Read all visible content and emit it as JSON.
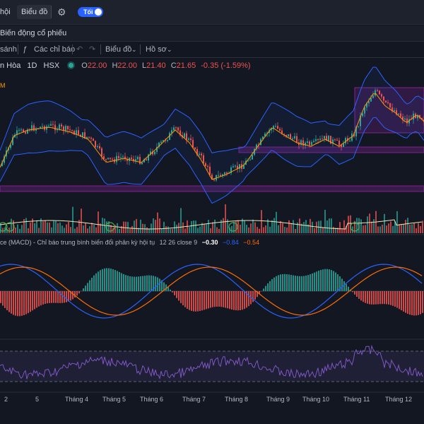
{
  "header": {
    "tab_partial": "hội",
    "chart_tab": "Biểu đồ",
    "toggle_label": "Tối"
  },
  "title_bar": {
    "text": "Biến động cổ phiếu"
  },
  "toolbar": {
    "compare_partial": "sánh",
    "indicators": "Các chỉ báo",
    "chart_type": "Biểu đồ",
    "profile": "Hồ sơ"
  },
  "symbol": {
    "name_partial": "n Hòa",
    "interval": "1D",
    "exchange": "HSX",
    "o_key": "O",
    "o_val": "22.00",
    "h_key": "H",
    "h_val": "22.00",
    "l_key": "L",
    "l_val": "21.40",
    "c_key": "C",
    "c_val": "21.65",
    "change": "-0.35 (-1.59%)",
    "pane_marker": "M"
  },
  "macd_legend": {
    "title": "ce (MACD) - Chỉ báo trung bình biến đổi phân kỳ hội tụ",
    "params": "12 26 close 9",
    "histogram": "−0.30",
    "macd": "−0.84",
    "signal": "−0.54"
  },
  "x_axis": [
    "2",
    "5",
    "Tháng 4",
    "Tháng 5",
    "Tháng 6",
    "Tháng 7",
    "Tháng 8",
    "Tháng 9",
    "Tháng 10",
    "Tháng 11",
    "Tháng 12"
  ],
  "colors": {
    "up": "#26a69a",
    "down": "#ef5350",
    "bollinger": "#2962ff",
    "ma": "#ff9800",
    "macd_line": "#2962ff",
    "signal_line": "#ff6d00",
    "rsi": "#7e57c2",
    "zone": "#9c27b0"
  },
  "icons": {
    "gear": "gear-icon",
    "undo": "undo-icon",
    "redo": "redo-icon",
    "fx": "fx-icon",
    "chevron": "chevron-down-icon"
  }
}
